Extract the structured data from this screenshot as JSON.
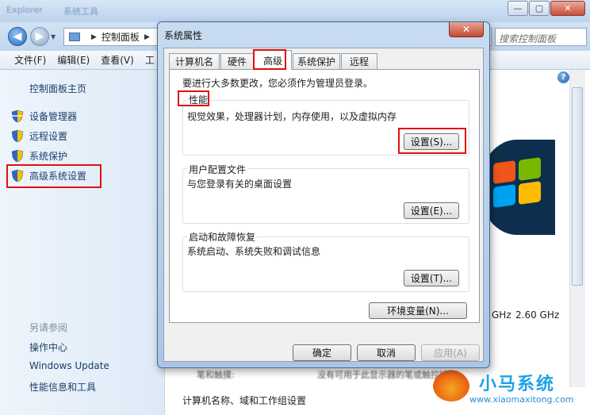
{
  "explorer": {
    "title_text": "Explorer",
    "title_text_2": "系统工具",
    "address": {
      "crumb1": "控制面板",
      "sep": "▶"
    },
    "search_placeholder": "搜索控制面板",
    "menu": [
      "文件(F)",
      "编辑(E)",
      "查看(V)",
      "工"
    ],
    "left_nav": {
      "home": "控制面板主页",
      "links": [
        "设备管理器",
        "远程设置",
        "系统保护",
        "高级系统设置"
      ],
      "see_also_title": "另请参阅",
      "see_also": [
        "操作中心",
        "Windows Update",
        "性能信息和工具"
      ]
    },
    "right": {
      "ghz_1": "GHz",
      "ghz_2": "2.60 GHz",
      "bottom_heading": "计算机名称、域和工作组设置",
      "faded_1": "笔和触摸:",
      "faded_2": "没有可用于此显示器的笔或触控输入"
    }
  },
  "dialog": {
    "title": "系统属性",
    "close_label": "✕",
    "tabs": [
      "计算机名",
      "硬件",
      "高级",
      "系统保护",
      "远程"
    ],
    "active_tab": "高级",
    "admin_note": "要进行大多数更改，您必须作为管理员登录。",
    "performance": {
      "title": "性能",
      "desc": "视觉效果，处理器计划，内存使用，以及虚拟内存",
      "button": "设置(S)..."
    },
    "profiles": {
      "title": "用户配置文件",
      "desc": "与您登录有关的桌面设置",
      "button": "设置(E)..."
    },
    "startup": {
      "title": "启动和故障恢复",
      "desc": "系统启动、系统失败和调试信息",
      "button": "设置(T)..."
    },
    "env_button": "环境变量(N)...",
    "ok": "确定",
    "cancel": "取消",
    "apply": "应用(A)"
  },
  "watermark": {
    "title": "小马系统",
    "url": "www.xiaomaxitong.com"
  },
  "colors": {
    "highlight": "#e01010",
    "link": "#1c3e6b",
    "watermark": "#1ea1e6"
  }
}
